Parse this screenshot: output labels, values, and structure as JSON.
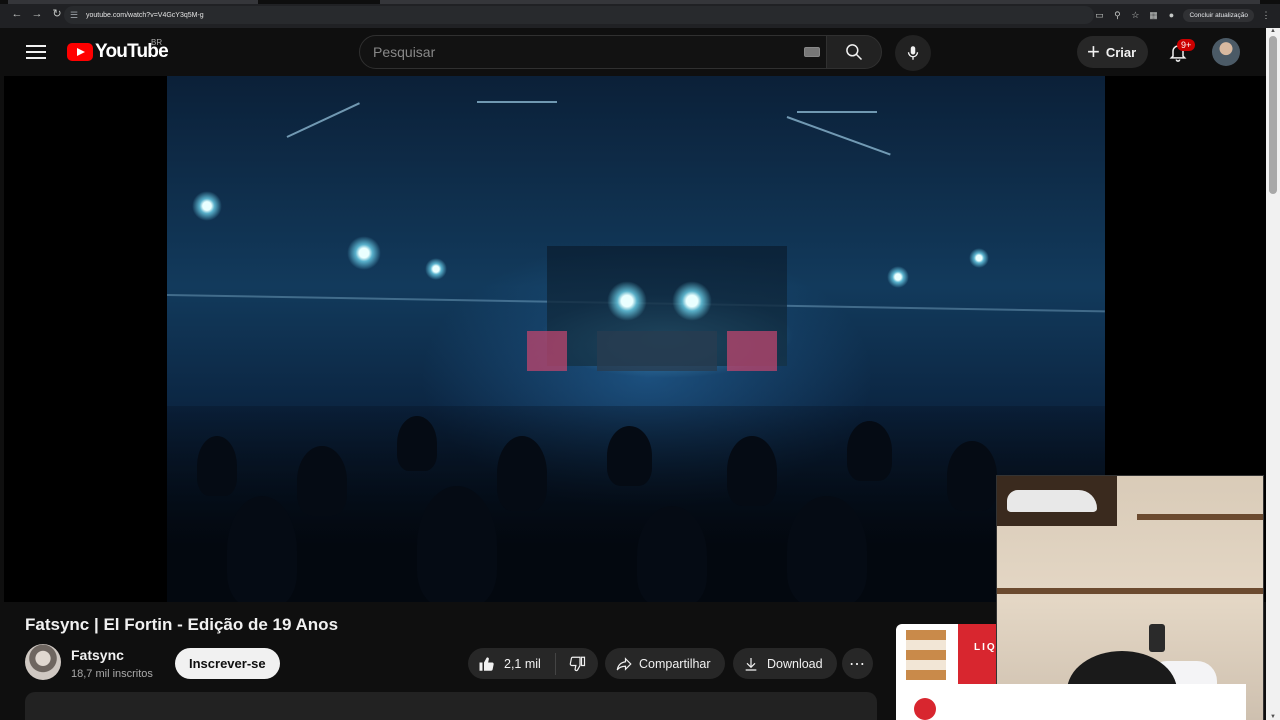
{
  "browser": {
    "url": "youtube.com/watch?v=V4GcY3q5M-g",
    "update_label": "Concluir atualização"
  },
  "masthead": {
    "logo_text": "YouTube",
    "country_code": "BR",
    "search_placeholder": "Pesquisar",
    "create_label": "Criar",
    "notification_count": "9+"
  },
  "video": {
    "title": "Fatsync | El Fortin - Edição de 19 Anos",
    "channel_name": "Fatsync",
    "channel_subs": "18,7 mil inscritos",
    "subscribe_label": "Inscrever-se",
    "likes": "2,1 mil",
    "share_label": "Compartilhar",
    "download_label": "Download"
  },
  "ad": {
    "brand_text": "LIQ"
  },
  "colors": {
    "brand_red": "#ff0000",
    "background": "#0f0f0f",
    "pill": "#272727"
  }
}
